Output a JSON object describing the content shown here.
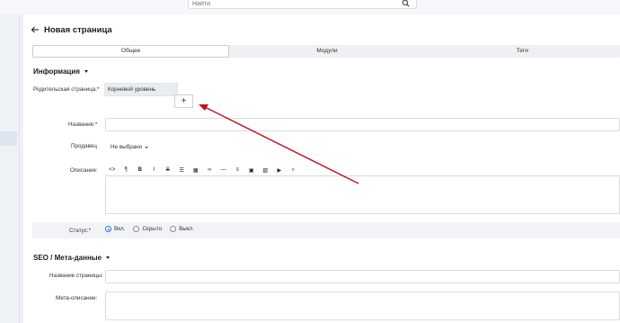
{
  "search": {
    "placeholder": "Найти"
  },
  "header": {
    "title": "Новая страница"
  },
  "tabs": [
    {
      "label": "Общее",
      "active": true
    },
    {
      "label": "Модули",
      "active": false
    },
    {
      "label": "Теги",
      "active": false
    }
  ],
  "info_section": {
    "title": "Информация",
    "parent_label": "Родительская страница:",
    "parent_value": "Корневой уровень",
    "add_symbol": "+",
    "name_label": "Название:",
    "seller_label": "Продавец",
    "seller_value": "Не выбрано",
    "description_label": "Описание:",
    "status_label": "Статус:",
    "status_options": [
      {
        "label": "Вкл.",
        "checked": true
      },
      {
        "label": "Скрыто",
        "checked": false
      },
      {
        "label": "Выкл.",
        "checked": false
      }
    ],
    "required_mark": "*"
  },
  "editor_toolbar": {
    "icons": [
      "code-icon",
      "paragraph-icon",
      "bold-icon",
      "italic-icon",
      "strikethrough-icon",
      "bullet-list-icon",
      "table-icon",
      "link-icon",
      "horizontal-rule-icon",
      "align-icon",
      "text-block-icon",
      "image-icon",
      "video-icon",
      "search-replace-icon"
    ],
    "glyphs": [
      "<>",
      "¶",
      "B",
      "I",
      "S",
      "☰",
      "▦",
      "∞",
      "—",
      "≡",
      "▣",
      "▨",
      "▶",
      "⌕"
    ]
  },
  "seo_section": {
    "title": "SEO / Мета-данные",
    "page_title_label": "Название страницы:",
    "meta_description_label": "Мета-описание:"
  },
  "annotation": {
    "arrow_color": "#c0141c"
  }
}
